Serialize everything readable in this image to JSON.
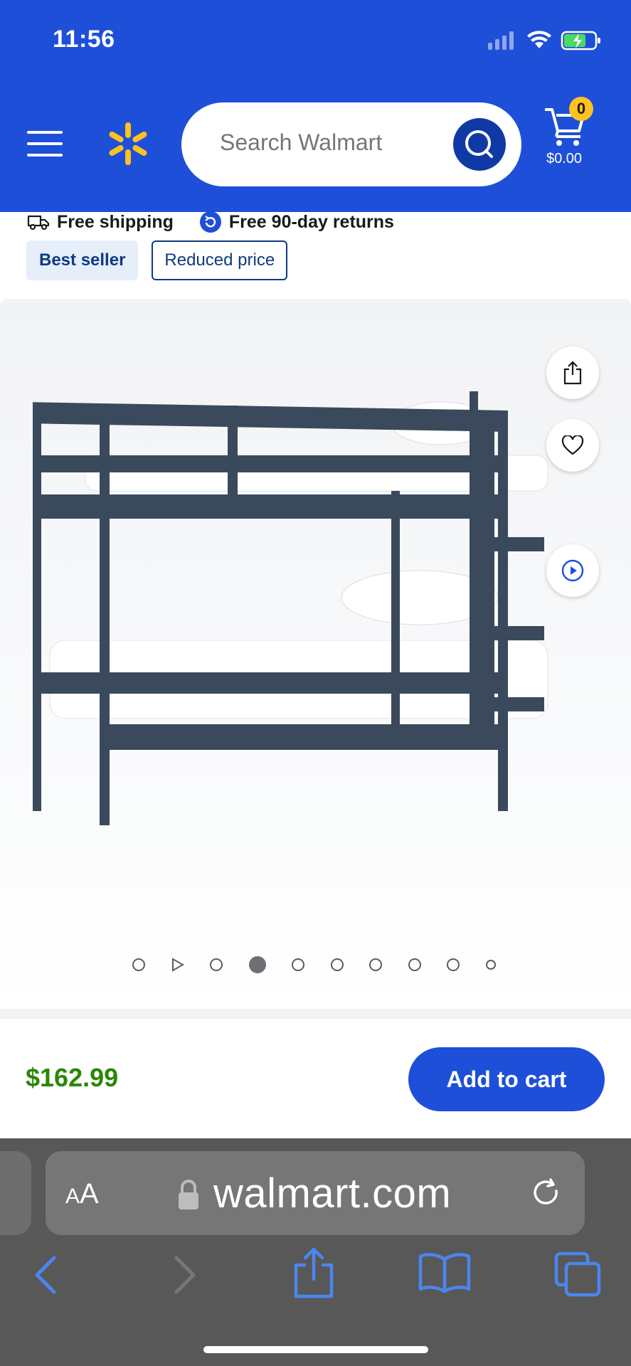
{
  "status_bar": {
    "time": "11:56"
  },
  "header": {
    "search": {
      "placeholder": "Search Walmart"
    },
    "cart": {
      "count": "0",
      "total": "$0.00"
    },
    "brand_color": "#1e4fd8",
    "spark_color": "#ffc220"
  },
  "perks": [
    {
      "icon": "truck-icon",
      "label": "Free shipping"
    },
    {
      "icon": "return-icon",
      "label": "Free 90-day returns"
    }
  ],
  "badges": {
    "best_seller": "Best seller",
    "reduced": "Reduced price"
  },
  "gallery": {
    "slide_count": 10,
    "active_slide": 4,
    "actions": [
      "share-icon",
      "heart-icon",
      "play-circle-icon"
    ],
    "product_image": "navy bunk bed with white mattresses and pillows"
  },
  "purchase": {
    "price": "$162.99",
    "add_to_cart": "Add to cart",
    "price_color": "#2a8703"
  },
  "browser": {
    "aa_label_big": "A",
    "aa_label_small": "A",
    "url": "walmart.com"
  }
}
